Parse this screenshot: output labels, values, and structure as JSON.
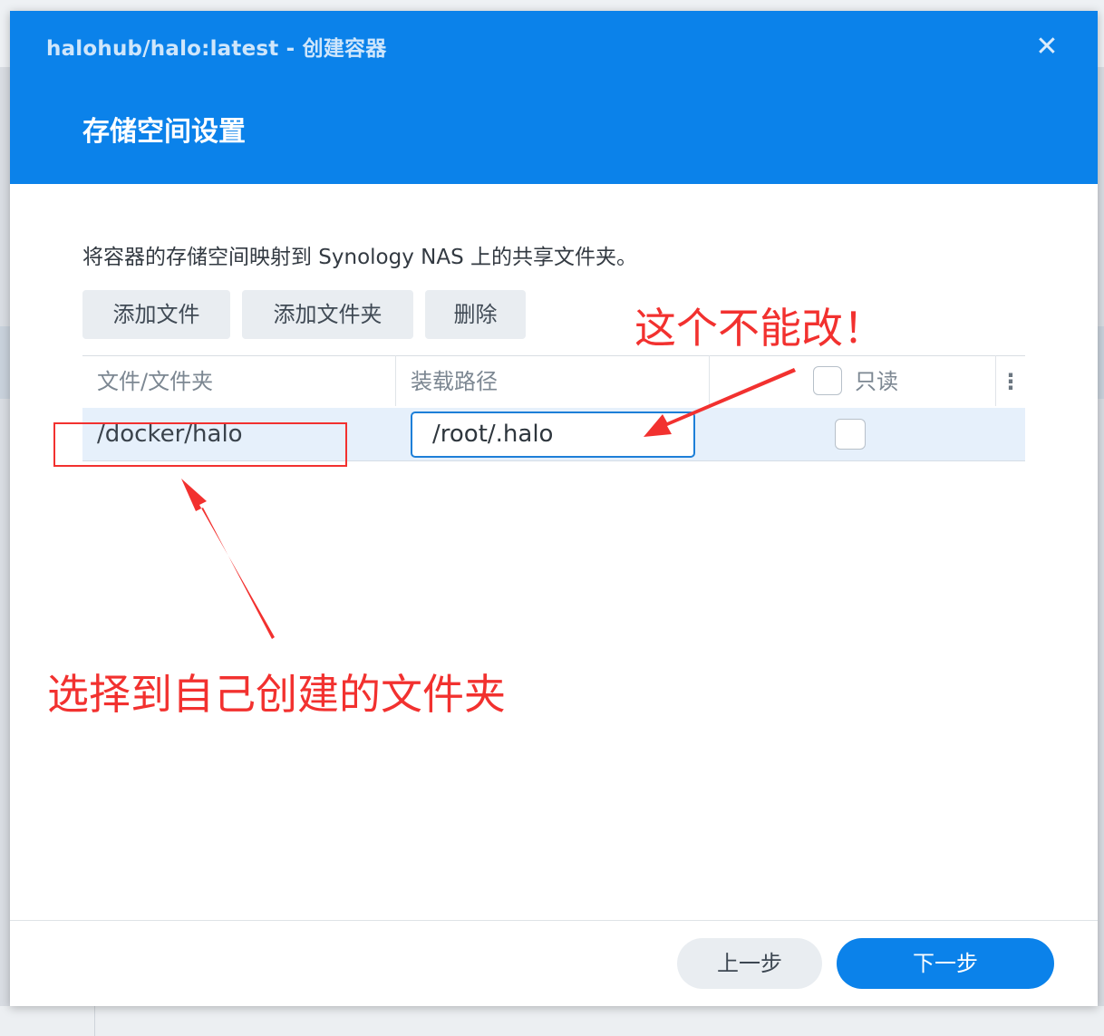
{
  "dialog": {
    "window_title": "halohub/halo:latest - 创建容器",
    "step_title": "存储空间设置",
    "description": "将容器的存储空间映射到 Synology NAS 上的共享文件夹。"
  },
  "toolbar": {
    "add_file": "添加文件",
    "add_folder": "添加文件夹",
    "delete": "删除"
  },
  "table": {
    "columns": {
      "file_folder": "文件/文件夹",
      "mount_path": "装载路径",
      "read_only": "只读"
    },
    "rows": [
      {
        "file_folder": "/docker/halo",
        "mount_path": "/root/.halo",
        "read_only": false
      }
    ]
  },
  "footer": {
    "prev": "上一步",
    "next": "下一步"
  },
  "annotations": {
    "cannot_change": "这个不能改！",
    "choose_folder": "选择到自己创建的文件夹"
  },
  "icons": {
    "close": "close-icon",
    "more": "more-vertical-icon"
  },
  "colors": {
    "accent": "#0b82ea",
    "annotation": "#f2312f",
    "row_selected": "#e6f0fb"
  }
}
